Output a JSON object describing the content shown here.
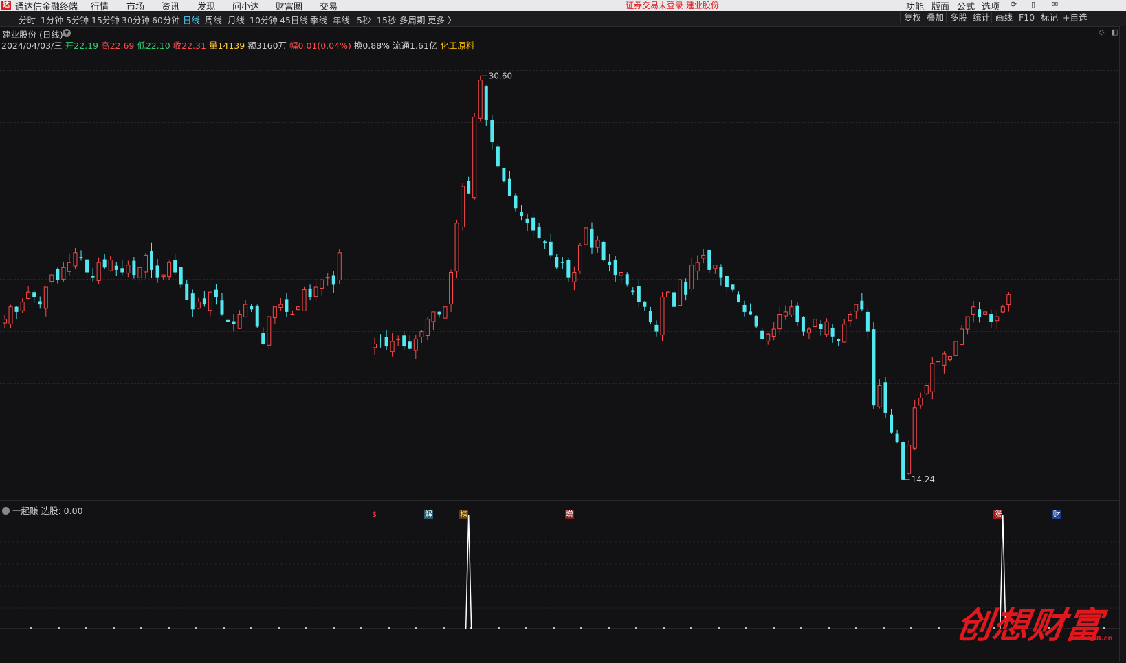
{
  "menubar": {
    "logo": "达",
    "app_title": "通达信金融终端",
    "items": [
      "行情",
      "市场",
      "资讯",
      "发现",
      "问小达",
      "财富圈",
      "交易"
    ],
    "notice": "证券交易未登录  建业股份",
    "right_items": [
      "功能",
      "版面",
      "公式",
      "选项"
    ],
    "right_icons": [
      "sync-icon",
      "phone-icon",
      "mail-icon"
    ]
  },
  "toolbar": {
    "periods": [
      "分时",
      "1分钟",
      "5分钟",
      "15分钟",
      "30分钟",
      "60分钟",
      "日线",
      "周线",
      "月线",
      "10分钟",
      "45日线",
      "季线",
      "年线",
      "5秒",
      "15秒",
      "多周期",
      "更多 〉"
    ],
    "active_period": "日线",
    "right_buttons": [
      "复权",
      "叠加",
      "多股",
      "统计",
      "画线",
      "F10",
      "标记",
      "+自选"
    ]
  },
  "stock": {
    "name": "建业股份 (日线)",
    "date": "2024/04/03/三",
    "open_label": "开",
    "open": "22.19",
    "high_label": "高",
    "high": "22.69",
    "low_label": "低",
    "low": "22.10",
    "close_label": "收",
    "close": "22.31",
    "vol_label": "量",
    "vol": "14139",
    "amount_label": "额",
    "amount": "3160万",
    "change_label": "幅",
    "change": "0.01(0.04%)",
    "turnover_label": "换",
    "turnover": "0.88%",
    "float_label": "流通",
    "float": "1.61亿",
    "sector": "化工原料"
  },
  "chart_data": {
    "type": "candlestick",
    "max_label": "30.60",
    "min_label": "14.24",
    "colors": {
      "up": "#ff4a4a",
      "down": "#54e8f0",
      "background": "#121214"
    },
    "price_range": [
      14.0,
      31.2
    ],
    "segments": [
      {
        "start": 0,
        "prices": [
          20.7,
          21.2,
          21.0,
          21.4,
          21.8,
          21.6,
          21.3,
          22.0,
          22.5,
          22.3,
          22.8,
          23.0,
          23.4,
          23.2,
          22.6,
          22.4,
          23.0,
          22.8,
          23.1,
          22.7,
          22.6,
          22.9,
          22.5,
          22.8,
          23.3,
          22.7,
          22.4,
          22.5,
          23.0,
          22.6,
          22.1,
          21.5,
          21.1,
          21.4,
          21.3,
          21.8,
          21.6,
          20.9,
          20.6,
          20.5,
          20.9,
          21.3,
          21.1,
          20.4,
          19.7,
          20.8,
          21.2,
          21.3,
          21.0,
          20.9,
          21.2,
          21.9,
          21.6,
          22.0,
          22.3,
          22.4,
          22.1,
          23.4
        ]
      },
      {
        "start": 63,
        "prices": [
          19.7,
          19.9,
          19.6,
          19.8,
          19.9,
          19.6,
          19.5,
          19.9,
          20.2,
          20.7,
          21.0,
          20.9,
          21.2,
          22.6,
          24.6,
          26.1,
          25.8,
          28.9,
          30.4,
          28.8,
          27.9,
          26.9,
          26.3,
          25.7,
          25.2,
          24.9,
          24.6,
          24.3,
          24.0,
          23.8,
          23.3,
          22.8,
          23.0,
          22.4,
          22.6,
          23.7,
          24.4,
          23.6,
          23.9,
          23.1,
          22.9,
          22.5,
          22.6,
          22.1,
          21.8,
          21.4,
          21.2,
          20.6,
          20.2,
          21.6,
          21.8,
          21.2,
          22.3,
          21.7,
          22.9,
          23.0,
          23.3,
          22.7,
          22.9,
          22.4,
          22.0,
          21.9,
          21.4,
          21.0,
          20.9,
          20.4,
          19.9,
          20.1,
          20.3,
          20.9,
          21.0,
          21.2,
          20.6,
          20.2,
          20.3,
          20.7,
          20.3,
          20.6,
          20.0,
          19.8,
          20.5,
          20.9,
          21.3,
          21.1,
          20.2,
          17.2,
          18.0,
          16.9,
          16.1,
          15.7,
          14.2,
          15.6,
          17.1,
          17.5,
          18.0,
          18.9,
          19.0,
          19.3,
          19.2,
          19.8,
          20.3,
          20.8,
          21.2,
          20.8,
          21.0,
          20.6,
          20.8,
          21.2,
          21.7
        ]
      }
    ],
    "markers": [
      {
        "label": "$",
        "bar": 63,
        "color": "#ff3a3a",
        "bg": ""
      },
      {
        "label": "解",
        "bar": 72,
        "color": "#ffffff",
        "bg": "#2a5a70"
      },
      {
        "label": "榜",
        "bar": 78,
        "color": "#ffd060",
        "bg": "#5a3a10"
      },
      {
        "label": "增",
        "bar": 96,
        "color": "#ffffff",
        "bg": "#7a1a1a"
      },
      {
        "label": "涨",
        "bar": 169,
        "color": "#ffffff",
        "bg": "#a01818"
      },
      {
        "label": "财",
        "bar": 179,
        "color": "#ffffff",
        "bg": "#1a3a8a"
      }
    ],
    "indicator": {
      "name": "一起赚",
      "label": "选股: 0.00",
      "value": "0.00",
      "signals_at_bars": [
        79,
        170
      ]
    }
  },
  "watermark": {
    "text": "创想财富",
    "url": "995168.cn"
  }
}
